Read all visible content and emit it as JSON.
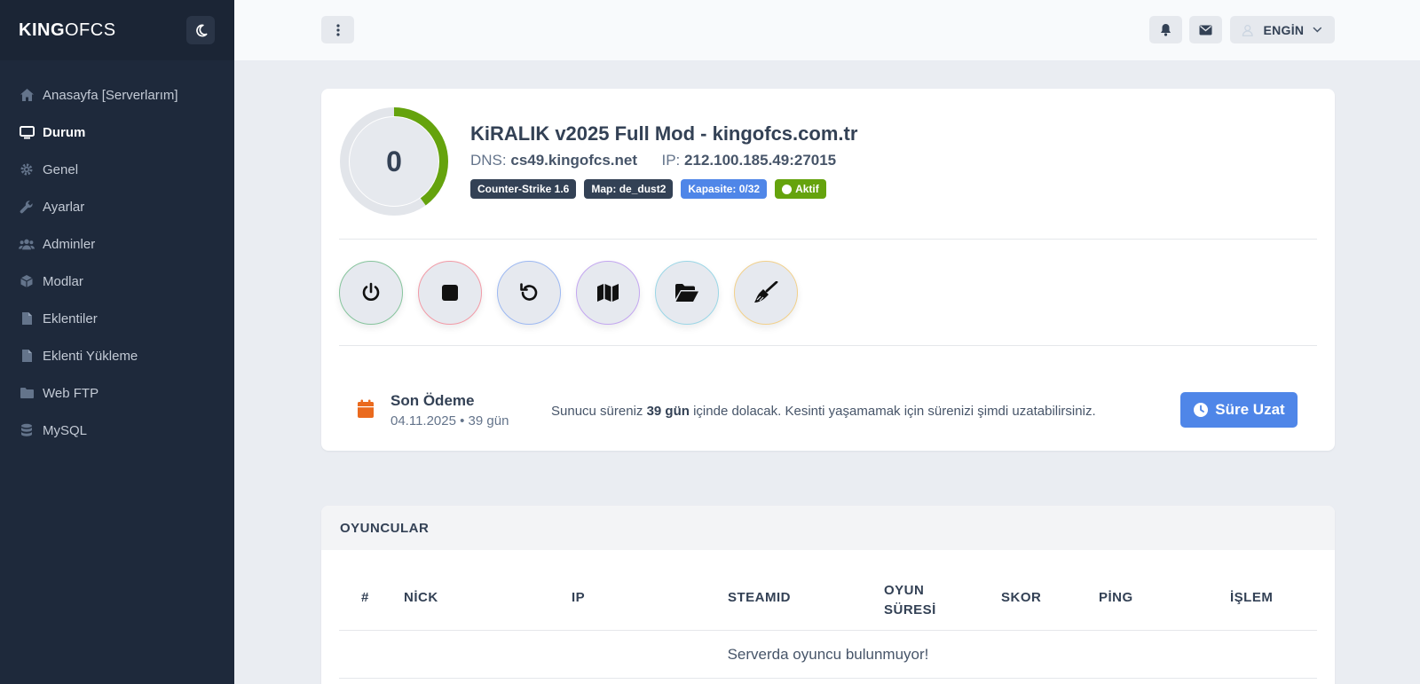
{
  "brand": {
    "bold": "KING",
    "light": "OFCS"
  },
  "sidebar": {
    "items": [
      {
        "label": "Anasayfa [Serverlarım]",
        "icon": "home-icon"
      },
      {
        "label": "Durum",
        "icon": "monitor-icon",
        "active": true
      },
      {
        "label": "Genel",
        "icon": "gear-icon"
      },
      {
        "label": "Ayarlar",
        "icon": "wrench-icon"
      },
      {
        "label": "Adminler",
        "icon": "users-icon"
      },
      {
        "label": "Modlar",
        "icon": "cube-icon"
      },
      {
        "label": "Eklentiler",
        "icon": "file-icon"
      },
      {
        "label": "Eklenti Yükleme",
        "icon": "file-icon"
      },
      {
        "label": "Web FTP",
        "icon": "folder-icon"
      },
      {
        "label": "MySQL",
        "icon": "database-icon"
      }
    ]
  },
  "topbar": {
    "user_name": "ENGİN"
  },
  "server": {
    "player_count": "0",
    "player_fraction": 0.4,
    "title": "KiRALIK v2025 Full Mod - kingofcs.com.tr",
    "dns_label": "DNS:",
    "dns_value": "cs49.kingofcs.net",
    "ip_label": "IP:",
    "ip_value": "212.100.185.49:27015",
    "badges": {
      "game": "Counter-Strike 1.6",
      "map": "Map: de_dust2",
      "capacity": "Kapasite: 0/32",
      "status": "Aktif"
    }
  },
  "payment": {
    "title": "Son Ödeme",
    "date": "04.11.2025 • 39 gün",
    "msg_before": "Sunucu süreniz ",
    "msg_bold": "39 gün",
    "msg_after": " içinde dolacak. Kesinti yaşamamak için sürenizi şimdi uzatabilirsiniz.",
    "button": "Süre Uzat"
  },
  "players": {
    "title": "OYUNCULAR",
    "columns": [
      "#",
      "NİCK",
      "IP",
      "STEAMID",
      "OYUN",
      "SÜRESİ",
      "SKOR",
      "PİNG",
      "İŞLEM"
    ],
    "empty": "Serverda oyuncu bulunmuyor!"
  },
  "colors": {
    "sidebar": "#1e293b",
    "accent": "#4f86e8",
    "success": "#65a30d",
    "gauge": "#65a30d"
  }
}
